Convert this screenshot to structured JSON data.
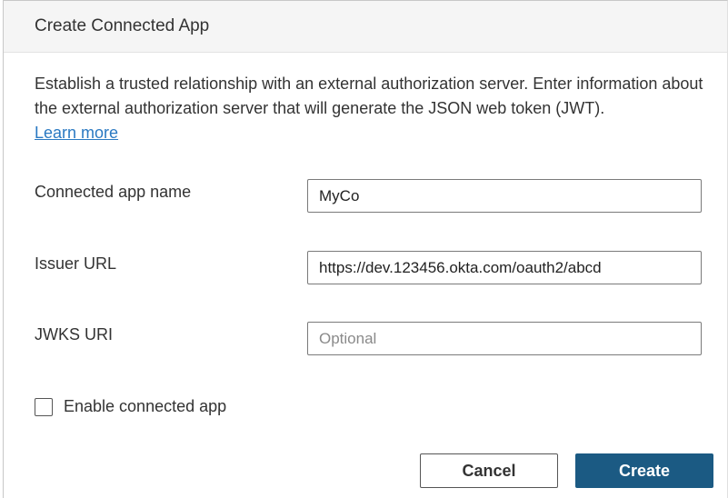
{
  "dialog": {
    "title": "Create Connected App",
    "description": "Establish a trusted relationship with an external authorization server. Enter information about the external authorization server that will generate the JSON web token (JWT).",
    "learn_more": "Learn more"
  },
  "form": {
    "app_name": {
      "label": "Connected app name",
      "value": "MyCo",
      "placeholder": ""
    },
    "issuer_url": {
      "label": "Issuer URL",
      "value": "https://dev.123456.okta.com/oauth2/abcd",
      "placeholder": ""
    },
    "jwks_uri": {
      "label": "JWKS URI",
      "value": "",
      "placeholder": "Optional"
    },
    "enable_checkbox": {
      "label": "Enable connected app",
      "checked": false
    }
  },
  "buttons": {
    "cancel": "Cancel",
    "create": "Create"
  },
  "colors": {
    "primary": "#1b5a83",
    "link": "#2a79c2",
    "header_bg": "#f5f5f5"
  }
}
